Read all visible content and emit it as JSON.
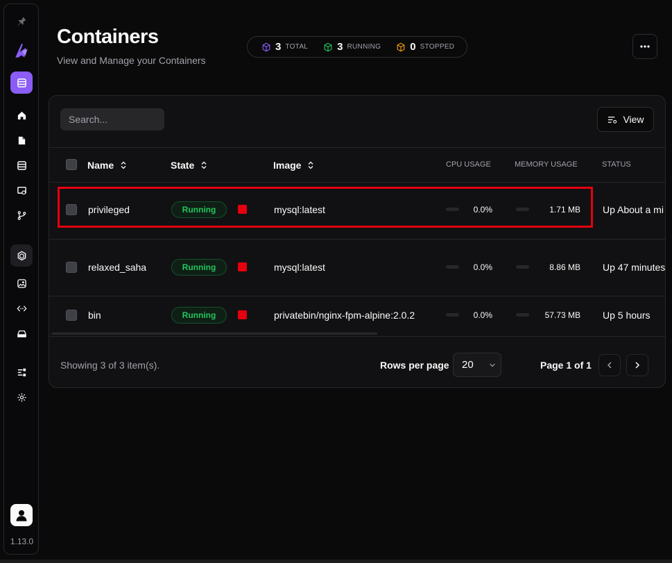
{
  "app": {
    "version": "1.13.0",
    "accent_color": "#8b5cf6"
  },
  "sidebar": {
    "top_icon": "pin-icon",
    "logo": "arcane-logo-icon",
    "items": [
      {
        "name": "home-icon",
        "active": false
      },
      {
        "name": "folder-icon",
        "active": false
      },
      {
        "name": "servers-icon",
        "active": false
      },
      {
        "name": "templates-icon",
        "active": false
      },
      {
        "name": "git-branch-icon",
        "active": false
      },
      {
        "name": "containers-icon",
        "active": true
      },
      {
        "name": "images-icon",
        "active": false
      },
      {
        "name": "networks-icon",
        "active": false
      },
      {
        "name": "volumes-icon",
        "active": false
      },
      {
        "name": "events-icon",
        "active": false
      },
      {
        "name": "settings-icon",
        "active": false
      }
    ],
    "user_icon": "user-avatar-icon"
  },
  "header": {
    "title": "Containers",
    "subtitle": "View and Manage your Containers",
    "more_icon": "more-horizontal-icon"
  },
  "stats": [
    {
      "value": "3",
      "label": "TOTAL",
      "color": "#8b5cf6"
    },
    {
      "value": "3",
      "label": "RUNNING",
      "color": "#22c55e"
    },
    {
      "value": "0",
      "label": "STOPPED",
      "color": "#f59e0b"
    }
  ],
  "toolbar": {
    "search_placeholder": "Search...",
    "view_label": "View"
  },
  "table": {
    "columns": {
      "name": "Name",
      "state": "State",
      "image": "Image",
      "cpu": "CPU USAGE",
      "memory": "MEMORY USAGE",
      "status": "STATUS"
    },
    "rows": [
      {
        "name": "privileged",
        "state": "Running",
        "image": "mysql:latest",
        "cpu": "0.0%",
        "memory": "1.71 MB",
        "status": "Up About a mi"
      },
      {
        "name": "relaxed_saha",
        "state": "Running",
        "image": "mysql:latest",
        "cpu": "0.0%",
        "memory": "8.86 MB",
        "status": "Up 47 minutes"
      },
      {
        "name": "bin",
        "state": "Running",
        "image": "privatebin/nginx-fpm-alpine:2.0.2",
        "cpu": "0.0%",
        "memory": "57.73 MB",
        "status": "Up 5 hours"
      }
    ]
  },
  "footer": {
    "showing": "Showing 3 of 3 item(s).",
    "rows_per_page_label": "Rows per page",
    "rows_per_page_value": "20",
    "page_label": "Page 1 of 1"
  }
}
